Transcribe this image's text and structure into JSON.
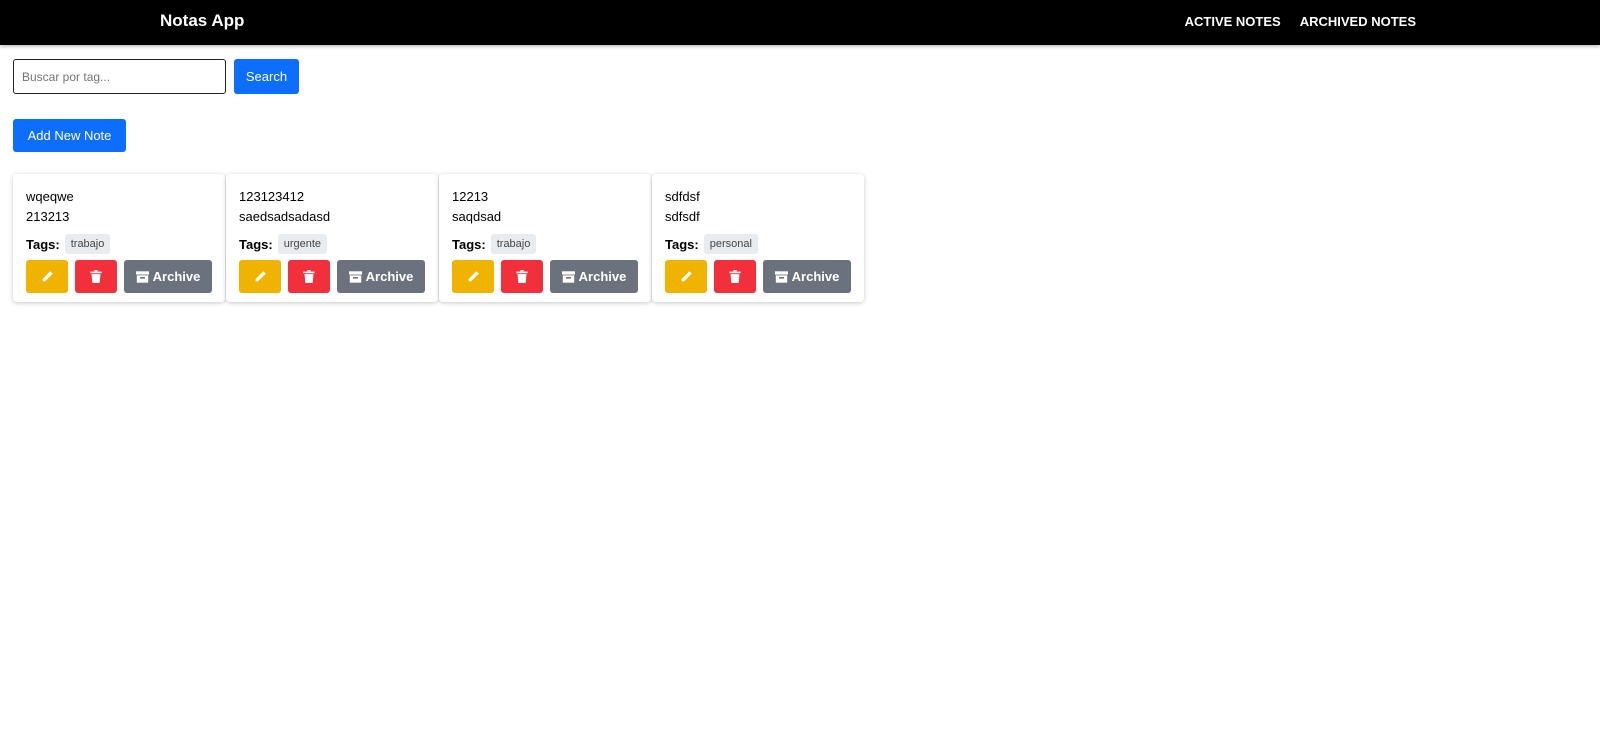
{
  "navbar": {
    "brand": "Notas App",
    "links": [
      "ACTIVE NOTES",
      "ARCHIVED NOTES"
    ]
  },
  "search": {
    "placeholder": "Buscar por tag...",
    "value": "",
    "button_label": "Search"
  },
  "add_button_label": "Add New Note",
  "tags_label": "Tags:",
  "archive_label": "Archive",
  "notes": [
    {
      "title": "wqeqwe",
      "content": "213213",
      "tag": "trabajo"
    },
    {
      "title": "123123412",
      "content": "saedsadsadasd",
      "tag": "urgente"
    },
    {
      "title": "12213",
      "content": "saqdsad",
      "tag": "trabajo"
    },
    {
      "title": "sdfdsf",
      "content": "sdfsdf",
      "tag": "personal"
    }
  ],
  "icons": {
    "edit": "pencil-icon",
    "delete": "trash-icon",
    "archive": "archive-box-icon"
  },
  "colors": {
    "navbar": "#000000",
    "primary": "#0d6efd",
    "edit": "#f0b400",
    "delete": "#f1303c",
    "archive": "#6c727d",
    "tag_bg": "#e9ecef"
  }
}
